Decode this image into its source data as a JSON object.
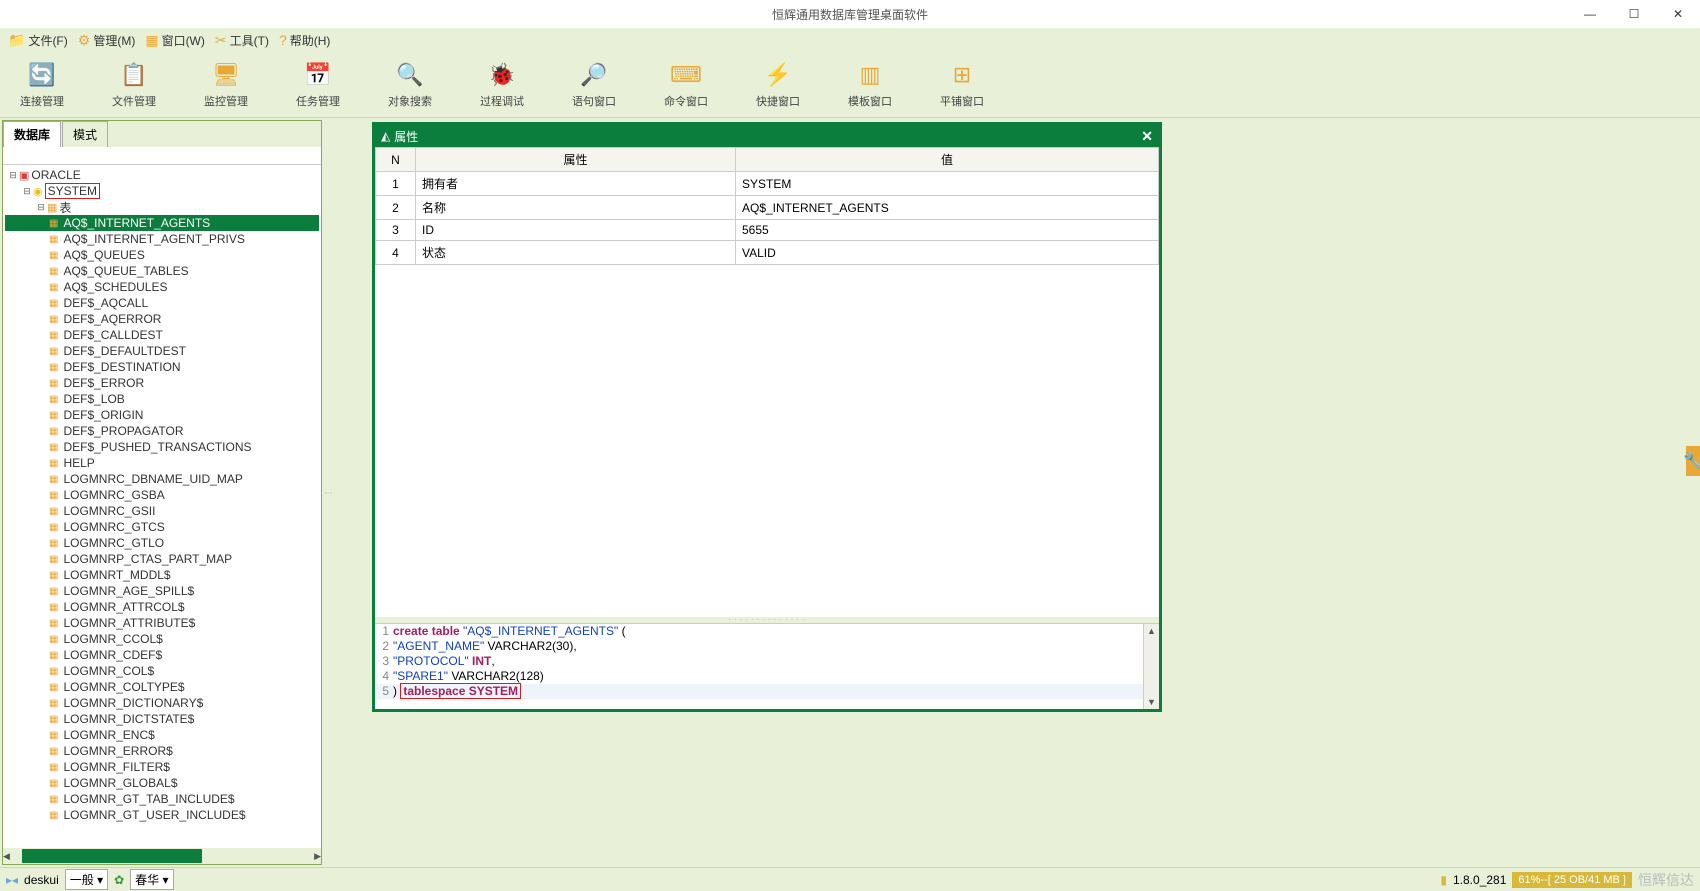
{
  "window": {
    "title": "恒辉通用数据库管理桌面软件"
  },
  "menus": [
    {
      "icon": "📁",
      "label": "文件(F)"
    },
    {
      "icon": "⚙",
      "label": "管理(M)"
    },
    {
      "icon": "▦",
      "label": "窗口(W)"
    },
    {
      "icon": "✂",
      "label": "工具(T)"
    },
    {
      "icon": "?",
      "label": "帮助(H)"
    }
  ],
  "toolbar": [
    {
      "icon": "🔄",
      "label": "连接管理"
    },
    {
      "icon": "📋",
      "label": "文件管理"
    },
    {
      "icon": "🖥",
      "label": "监控管理"
    },
    {
      "icon": "📅",
      "label": "任务管理"
    },
    {
      "icon": "🔍",
      "label": "对象搜索"
    },
    {
      "icon": "🐞",
      "label": "过程调试"
    },
    {
      "icon": "🔎",
      "label": "语句窗口"
    },
    {
      "icon": "⌨",
      "label": "命令窗口"
    },
    {
      "icon": "⚡",
      "label": "快捷窗口"
    },
    {
      "icon": "▥",
      "label": "模板窗口"
    },
    {
      "icon": "⊞",
      "label": "平铺窗口"
    }
  ],
  "tabs": {
    "active": "数据库",
    "other": "模式"
  },
  "tree": {
    "root": "ORACLE",
    "schema": "SYSTEM",
    "folder": "表",
    "selected": "AQ$_INTERNET_AGENTS",
    "tables": [
      "AQ$_INTERNET_AGENT_PRIVS",
      "AQ$_QUEUES",
      "AQ$_QUEUE_TABLES",
      "AQ$_SCHEDULES",
      "DEF$_AQCALL",
      "DEF$_AQERROR",
      "DEF$_CALLDEST",
      "DEF$_DEFAULTDEST",
      "DEF$_DESTINATION",
      "DEF$_ERROR",
      "DEF$_LOB",
      "DEF$_ORIGIN",
      "DEF$_PROPAGATOR",
      "DEF$_PUSHED_TRANSACTIONS",
      "HELP",
      "LOGMNRC_DBNAME_UID_MAP",
      "LOGMNRC_GSBA",
      "LOGMNRC_GSII",
      "LOGMNRC_GTCS",
      "LOGMNRC_GTLO",
      "LOGMNRP_CTAS_PART_MAP",
      "LOGMNRT_MDDL$",
      "LOGMNR_AGE_SPILL$",
      "LOGMNR_ATTRCOL$",
      "LOGMNR_ATTRIBUTE$",
      "LOGMNR_CCOL$",
      "LOGMNR_CDEF$",
      "LOGMNR_COL$",
      "LOGMNR_COLTYPE$",
      "LOGMNR_DICTIONARY$",
      "LOGMNR_DICTSTATE$",
      "LOGMNR_ENC$",
      "LOGMNR_ERROR$",
      "LOGMNR_FILTER$",
      "LOGMNR_GLOBAL$",
      "LOGMNR_GT_TAB_INCLUDE$",
      "LOGMNR_GT_USER_INCLUDE$"
    ]
  },
  "props": {
    "title": "属性",
    "headers": {
      "n": "N",
      "k": "属性",
      "v": "值"
    },
    "rows": [
      {
        "n": "1",
        "k": "拥有者",
        "v": "SYSTEM"
      },
      {
        "n": "2",
        "k": "名称",
        "v": "AQ$_INTERNET_AGENTS"
      },
      {
        "n": "3",
        "k": "ID",
        "v": "5655"
      },
      {
        "n": "4",
        "k": "状态",
        "v": "VALID"
      }
    ]
  },
  "sql": {
    "l1a": "create table ",
    "l1b": "\"AQ$_INTERNET_AGENTS\"",
    "l1c": " (",
    "l2a": "\"AGENT_NAME\"",
    "l2b": " VARCHAR2(30),",
    "l3a": "\"PROTOCOL\" ",
    "l3b": "INT",
    "l3c": ",",
    "l4a": "\"SPARE1\"",
    "l4b": " VARCHAR2(128)",
    "l5a": ") ",
    "l5b": "tablespace SYSTEM"
  },
  "status": {
    "app": "deskui",
    "combo": "一般",
    "theme": "春华",
    "version": "1.8.0_281",
    "mem": "61%--[ 25 OB/41 MB ]",
    "watermark": "恒辉信达"
  }
}
